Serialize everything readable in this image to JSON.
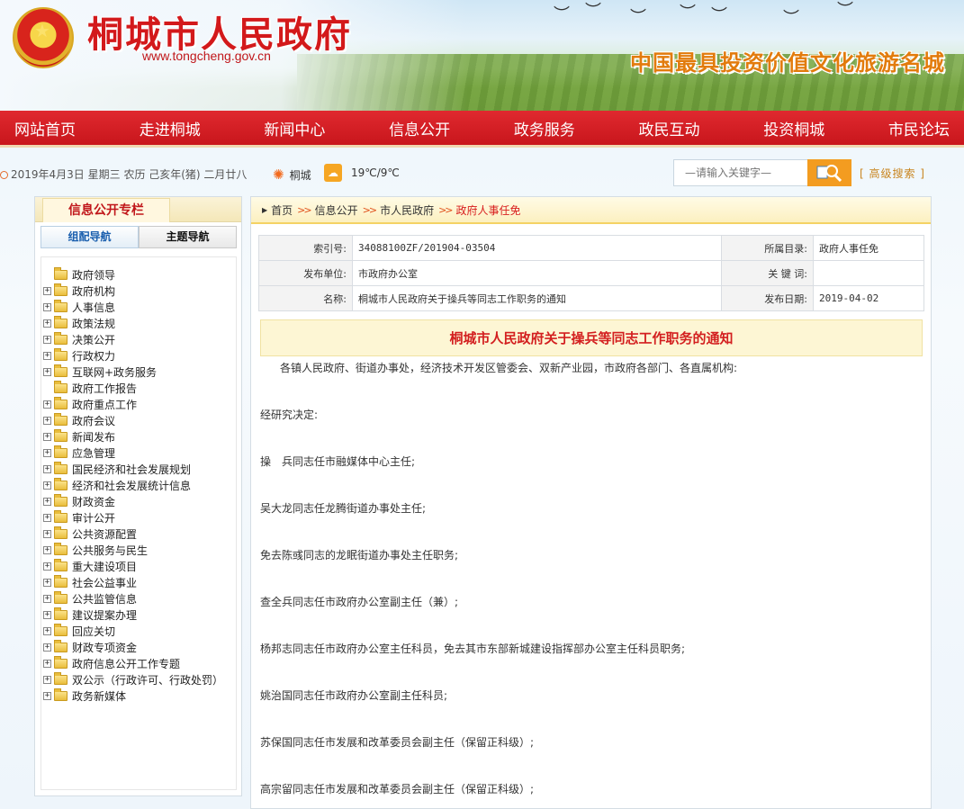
{
  "header": {
    "site_title": "桐城市人民政府",
    "site_url": "www.tongcheng.gov.cn",
    "slogan": "中国最具投资价值文化旅游名城"
  },
  "nav": [
    "网站首页",
    "走进桐城",
    "新闻中心",
    "信息公开",
    "政务服务",
    "政民互动",
    "投资桐城",
    "市民论坛"
  ],
  "info": {
    "date": "2019年4月3日 星期三 农历 己亥年(猪) 二月廿八",
    "city": "桐城",
    "temperature": "19℃/9℃",
    "search_placeholder": "—请输入关键字—",
    "advanced_search": "[ 高级搜索 ]"
  },
  "sidebar": {
    "title": "信息公开专栏",
    "tab_org": "组配导航",
    "tab_topic": "主题导航",
    "tree": [
      {
        "label": "政府领导",
        "expandable": false
      },
      {
        "label": "政府机构",
        "expandable": true
      },
      {
        "label": "人事信息",
        "expandable": true
      },
      {
        "label": "政策法规",
        "expandable": true
      },
      {
        "label": "决策公开",
        "expandable": true
      },
      {
        "label": "行政权力",
        "expandable": true
      },
      {
        "label": "互联网+政务服务",
        "expandable": true
      },
      {
        "label": "政府工作报告",
        "expandable": false
      },
      {
        "label": "政府重点工作",
        "expandable": true
      },
      {
        "label": "政府会议",
        "expandable": true
      },
      {
        "label": "新闻发布",
        "expandable": true
      },
      {
        "label": "应急管理",
        "expandable": true
      },
      {
        "label": "国民经济和社会发展规划",
        "expandable": true
      },
      {
        "label": "经济和社会发展统计信息",
        "expandable": true
      },
      {
        "label": "财政资金",
        "expandable": true
      },
      {
        "label": "审计公开",
        "expandable": true
      },
      {
        "label": "公共资源配置",
        "expandable": true
      },
      {
        "label": "公共服务与民生",
        "expandable": true
      },
      {
        "label": "重大建设项目",
        "expandable": true
      },
      {
        "label": "社会公益事业",
        "expandable": true
      },
      {
        "label": "公共监管信息",
        "expandable": true
      },
      {
        "label": "建议提案办理",
        "expandable": true
      },
      {
        "label": "回应关切",
        "expandable": true
      },
      {
        "label": "财政专项资金",
        "expandable": true
      },
      {
        "label": "政府信息公开工作专题",
        "expandable": true
      },
      {
        "label": "双公示（行政许可、行政处罚）",
        "expandable": true
      },
      {
        "label": "政务新媒体",
        "expandable": true
      }
    ]
  },
  "breadcrumb": {
    "home": "首页",
    "level1": "信息公开",
    "level2": "市人民政府",
    "current": "政府人事任免",
    "sep": ">>"
  },
  "meta": {
    "index_label": "索引号:",
    "index_value": "34088100ZF/201904-03504",
    "catalog_label": "所属目录:",
    "catalog_value": "政府人事任免",
    "publisher_label": "发布单位:",
    "publisher_value": "市政府办公室",
    "keywords_label": "关 键 词:",
    "keywords_value": "",
    "name_label": "名称:",
    "name_value": "桐城市人民政府关于操兵等同志工作职务的通知",
    "date_label": "发布日期:",
    "date_value": "2019-04-02"
  },
  "document": {
    "title": "桐城市人民政府关于操兵等同志工作职务的通知",
    "paragraphs": [
      "各镇人民政府、街道办事处，经济技术开发区管委会、双新产业园，市政府各部门、各直属机构:",
      "经研究决定:",
      "操　兵同志任市融媒体中心主任;",
      "吴大龙同志任龙腾街道办事处主任;",
      "免去陈彧同志的龙眠街道办事处主任职务;",
      "查全兵同志任市政府办公室副主任（兼）;",
      "杨邦志同志任市政府办公室主任科员，免去其市东部新城建设指挥部办公室主任科员职务;",
      "姚治国同志任市政府办公室副主任科员;",
      "苏保国同志任市发展和改革委员会副主任（保留正科级）;",
      "高宗留同志任市发展和改革委员会副主任（保留正科级）;"
    ]
  },
  "colors": {
    "nav_red": "#d21e24",
    "title_red": "#d3191b",
    "slogan_orange": "#e27b0c",
    "search_orange": "#f39c20"
  }
}
